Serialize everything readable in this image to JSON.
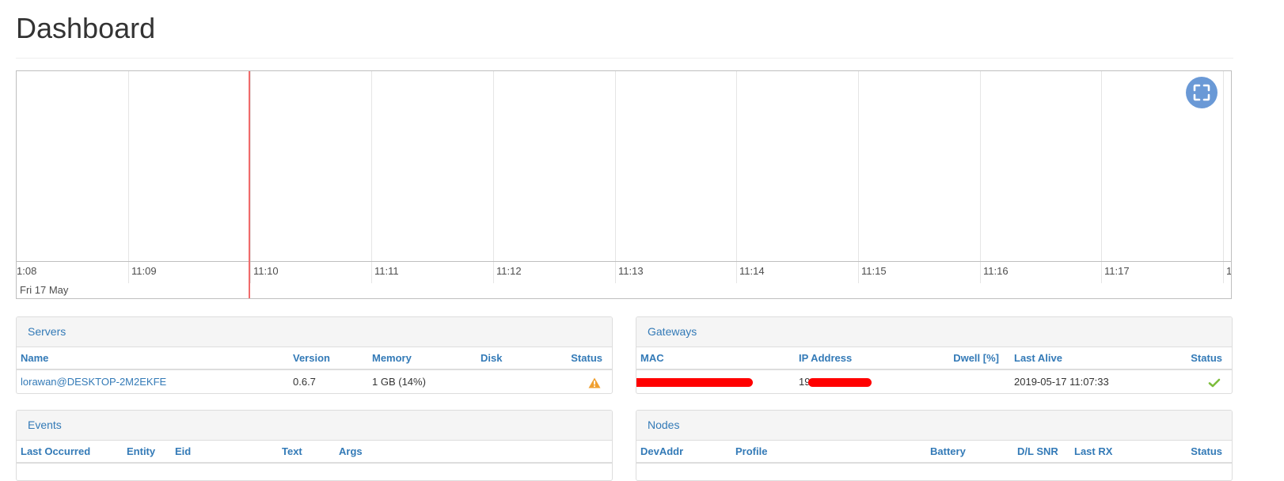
{
  "page": {
    "title": "Dashboard"
  },
  "timeline": {
    "ticks": [
      "1:08",
      "11:09",
      "11:10",
      "11:11",
      "11:12",
      "11:13",
      "11:14",
      "11:15",
      "11:16",
      "11:17",
      "1"
    ],
    "date_label": "Fri 17 May",
    "fullscreen_icon": "fullscreen-icon",
    "colors": {
      "current_time_marker": "#f06b6b",
      "fullscreen_button": "#6a99d6"
    }
  },
  "servers": {
    "title": "Servers",
    "columns": [
      "Name",
      "Version",
      "Memory",
      "Disk",
      "Status"
    ],
    "rows": [
      {
        "name": "lorawan@DESKTOP-2M2EKFE",
        "version": "0.6.7",
        "memory": "1 GB (14%)",
        "disk": "",
        "status_icon": "warning-icon"
      }
    ]
  },
  "gateways": {
    "title": "Gateways",
    "columns": [
      "MAC",
      "IP Address",
      "Dwell [%]",
      "Last Alive",
      "Status"
    ],
    "rows": [
      {
        "mac": "",
        "ip_prefix": "19",
        "dwell": "",
        "last_alive": "2019-05-17 11:07:33",
        "status_icon": "check-icon"
      }
    ]
  },
  "events": {
    "title": "Events",
    "columns": [
      "Last Occurred",
      "Entity",
      "Eid",
      "Text",
      "Args"
    ]
  },
  "nodes": {
    "title": "Nodes",
    "columns": [
      "DevAddr",
      "Profile",
      "Battery",
      "D/L SNR",
      "Last RX",
      "Status"
    ]
  },
  "colors": {
    "link": "#337ab7",
    "warning": "#f0a030",
    "ok": "#7dbd3c",
    "redaction": "#ff0000"
  }
}
